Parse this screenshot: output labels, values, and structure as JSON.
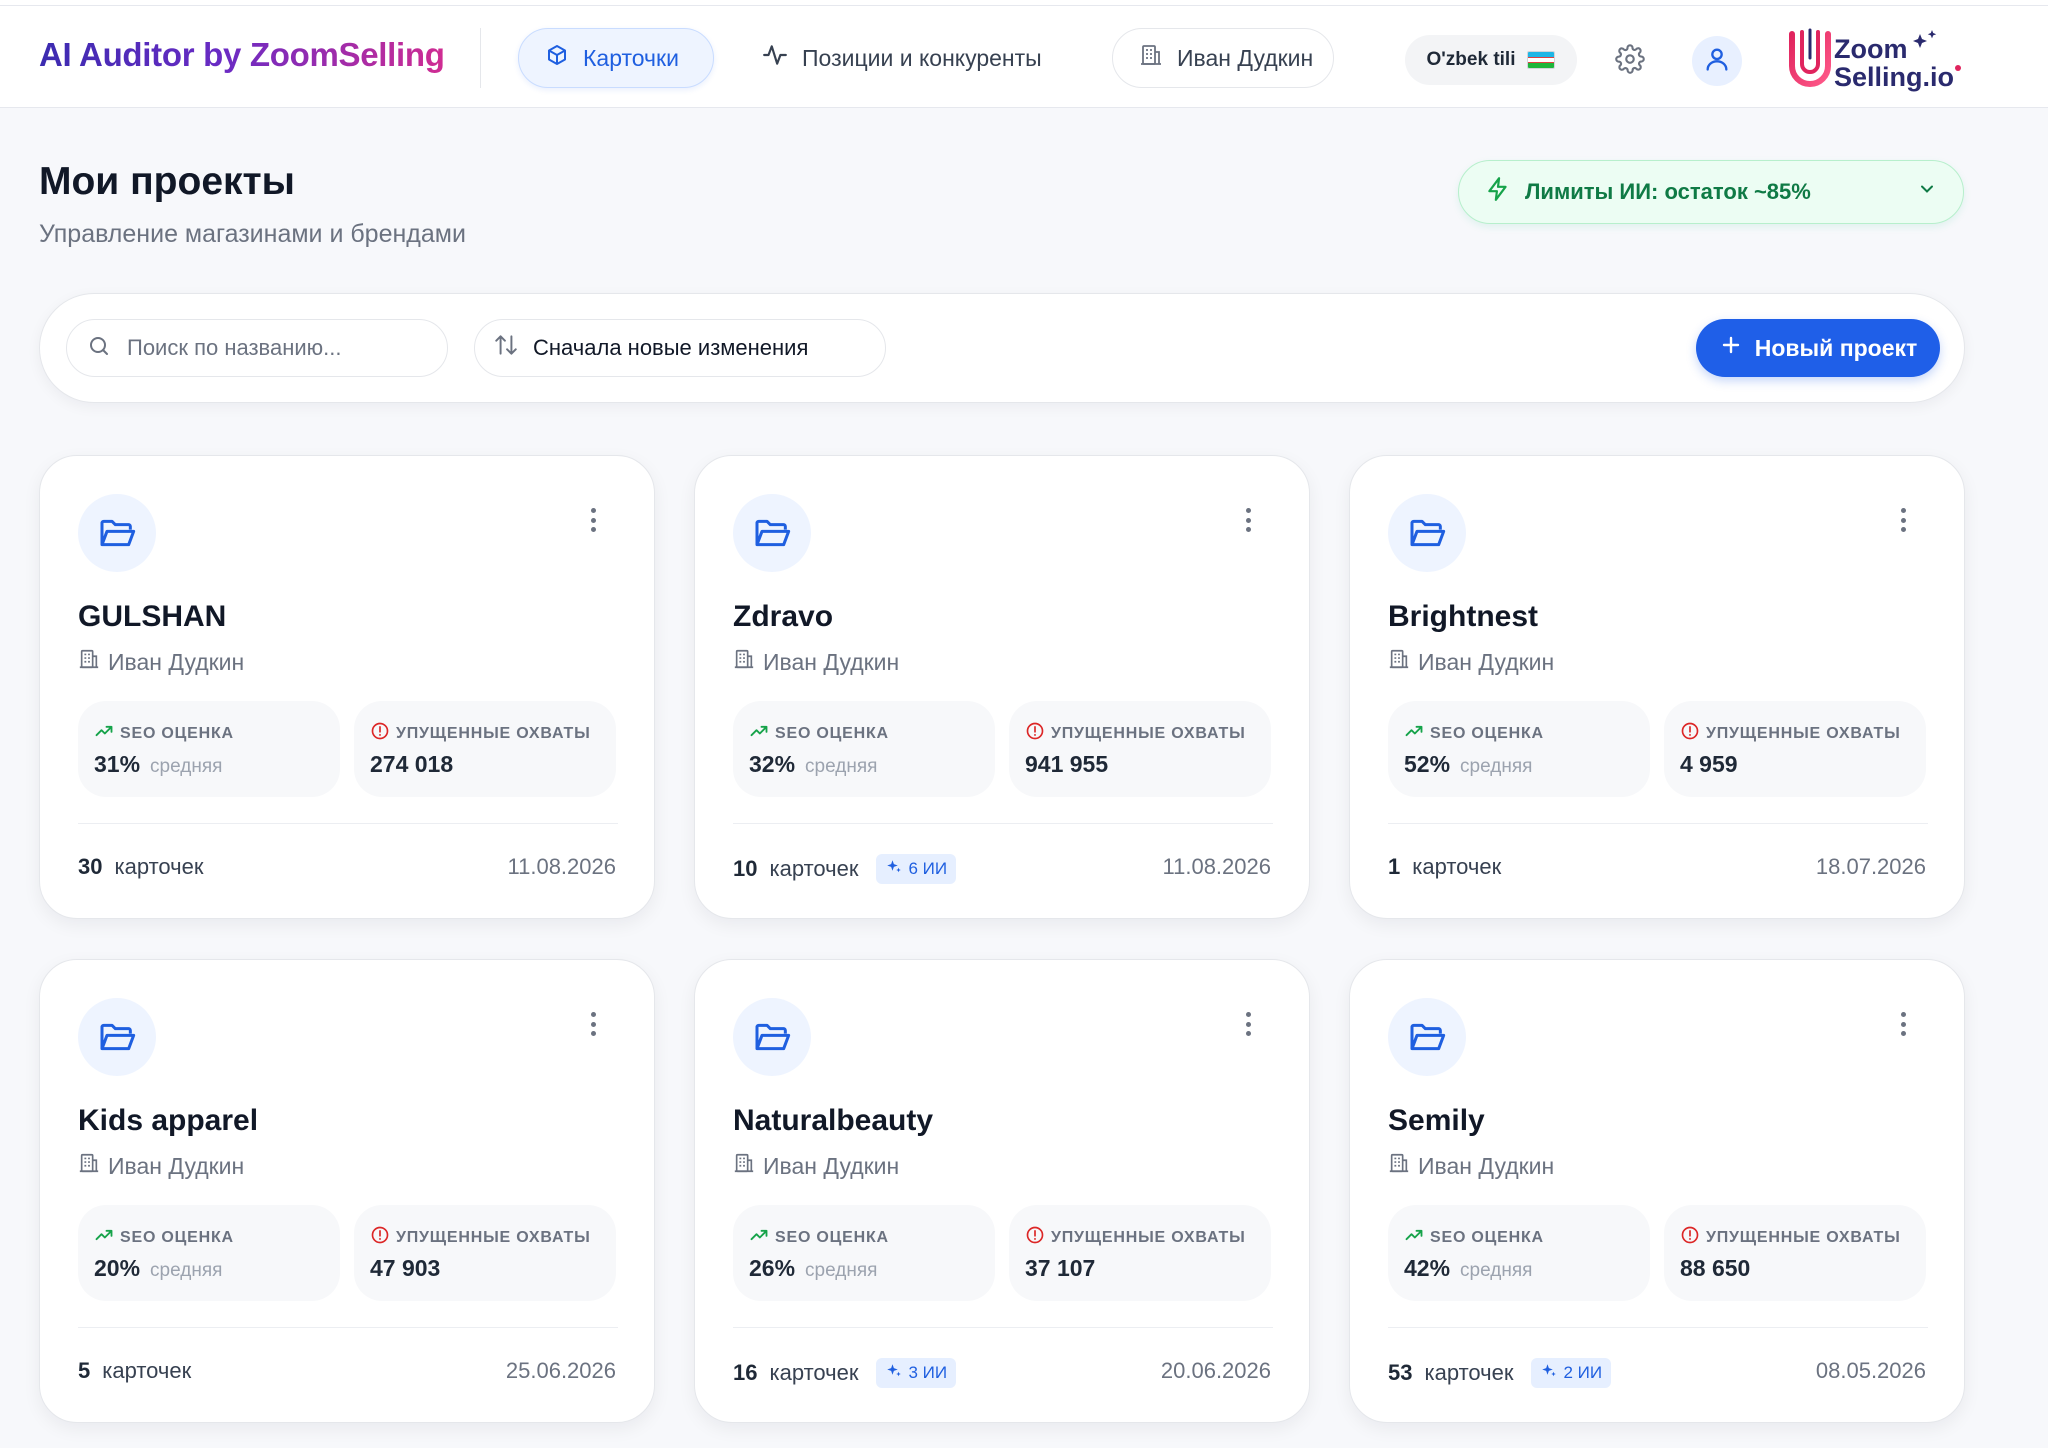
{
  "header": {
    "brand": "AI Auditor by ZoomSelling",
    "nav": {
      "cards_label": "Карточки",
      "positions_label": "Позиции и конкуренты",
      "owner_label": "Иван Дудкин"
    },
    "language_label": "O'zbek tili",
    "logo": {
      "line1": "Zoom",
      "line2": "Selling.io"
    }
  },
  "page": {
    "title": "Мои проекты",
    "subtitle": "Управление магазинами и брендами"
  },
  "limits": {
    "label": "Лимиты ИИ: остаток ~85%",
    "remaining_percent": 85
  },
  "toolbar": {
    "search_placeholder": "Поиск по названию...",
    "sort_label": "Сначала новые изменения",
    "new_project_label": "Новый проект"
  },
  "metric_labels": {
    "seo": "SEO ОЦЕНКА",
    "lost": "УПУЩЕННЫЕ ОХВАТЫ"
  },
  "projects": [
    {
      "name": "GULSHAN",
      "owner": "Иван Дудкин",
      "seo": "31%",
      "seo_quality": "средняя",
      "lost_reach": "274 018",
      "cards_count": "30",
      "cards_word": "карточек",
      "ai_badge": "",
      "date": "11.08.2026"
    },
    {
      "name": "Zdravo",
      "owner": "Иван Дудкин",
      "seo": "32%",
      "seo_quality": "средняя",
      "lost_reach": "941 955",
      "cards_count": "10",
      "cards_word": "карточек",
      "ai_badge": "6 ИИ",
      "date": "11.08.2026"
    },
    {
      "name": "Brightnest",
      "owner": "Иван Дудкин",
      "seo": "52%",
      "seo_quality": "средняя",
      "lost_reach": "4 959",
      "cards_count": "1",
      "cards_word": "карточек",
      "ai_badge": "",
      "date": "18.07.2026"
    },
    {
      "name": "Kids apparel",
      "owner": "Иван Дудкин",
      "seo": "20%",
      "seo_quality": "средняя",
      "lost_reach": "47 903",
      "cards_count": "5",
      "cards_word": "карточек",
      "ai_badge": "",
      "date": "25.06.2026"
    },
    {
      "name": "Naturalbeauty",
      "owner": "Иван Дудкин",
      "seo": "26%",
      "seo_quality": "средняя",
      "lost_reach": "37 107",
      "cards_count": "16",
      "cards_word": "карточек",
      "ai_badge": "3 ИИ",
      "date": "20.06.2026"
    },
    {
      "name": "Semily",
      "owner": "Иван Дудкин",
      "seo": "42%",
      "seo_quality": "средняя",
      "lost_reach": "88 650",
      "cards_count": "53",
      "cards_word": "карточек",
      "ai_badge": "2 ИИ",
      "date": "08.05.2026"
    }
  ],
  "colors": {
    "primary": "#1f5fe8",
    "brand_start": "#3b2bb0",
    "brand_end": "#d02c92",
    "success_bg": "#ecfdf3",
    "success_text": "#0f7a45",
    "error": "#dc2626",
    "trend": "#16a34a"
  },
  "icons": {
    "nav_cards": "box-icon",
    "nav_positions": "activity-icon",
    "owner": "building-icon",
    "settings": "gear-icon",
    "user": "user-icon",
    "limits": "zap-icon",
    "search": "search-icon",
    "sort": "sort-arrows-icon",
    "new_project": "plus-icon",
    "project": "folder-open-icon",
    "menu": "more-vertical-icon",
    "seo": "trending-up-icon",
    "lost": "alert-circle-icon",
    "ai": "sparkles-icon"
  }
}
